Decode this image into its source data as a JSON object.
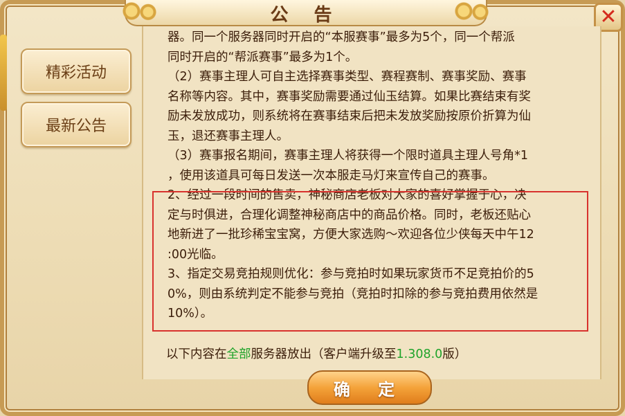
{
  "dialog": {
    "title": "公 告",
    "close_label": "✕"
  },
  "sidebar": {
    "items": [
      {
        "label": "精彩活动"
      },
      {
        "label": "最新公告"
      }
    ]
  },
  "content": {
    "lines": [
      "器。同一个服务器同时开启的“本服赛事”最多为5个，同一个帮派",
      "同时开启的“帮派赛事”最多为1个。",
      "（2）赛事主理人可自主选择赛事类型、赛程赛制、赛事奖励、赛事",
      "名称等内容。其中，赛事奖励需要通过仙玉结算。如果比赛结束有奖",
      "励未发放成功，则系统将在赛事结束后把未发放奖励按原价折算为仙",
      "玉，退还赛事主理人。",
      "（3）赛事报名期间，赛事主理人将获得一个限时道具主理人号角*1",
      "，使用该道具可每日发送一次本服走马灯来宣传自己的赛事。",
      "2、经过一段时间的售卖，神秘商店老板对大家的喜好掌握于心，决",
      "定与时俱进，合理化调整神秘商店中的商品价格。同时，老板还贴心",
      "地新进了一批珍稀宝宝窝，方便大家选购～欢迎各位少侠每天中午12",
      ":00光临。",
      "3、指定交易竞拍规则优化：参与竞拍时如果玩家货币不足竞拍价的5",
      "0%，则由系统判定不能参与竞拍（竞拍时扣除的参与竞拍费用依然是",
      "10%）。"
    ],
    "footer": {
      "part1": "以下内容在",
      "part2_green": "全部",
      "part3": "服务器放出（客户端升级至",
      "version_green": "1.308.0",
      "part4": "版）"
    }
  },
  "buttons": {
    "confirm_label": "确 定"
  },
  "colors": {
    "highlight_border": "#d8322d",
    "green_text": "#1fa32a",
    "close_x": "#d42a1d"
  }
}
